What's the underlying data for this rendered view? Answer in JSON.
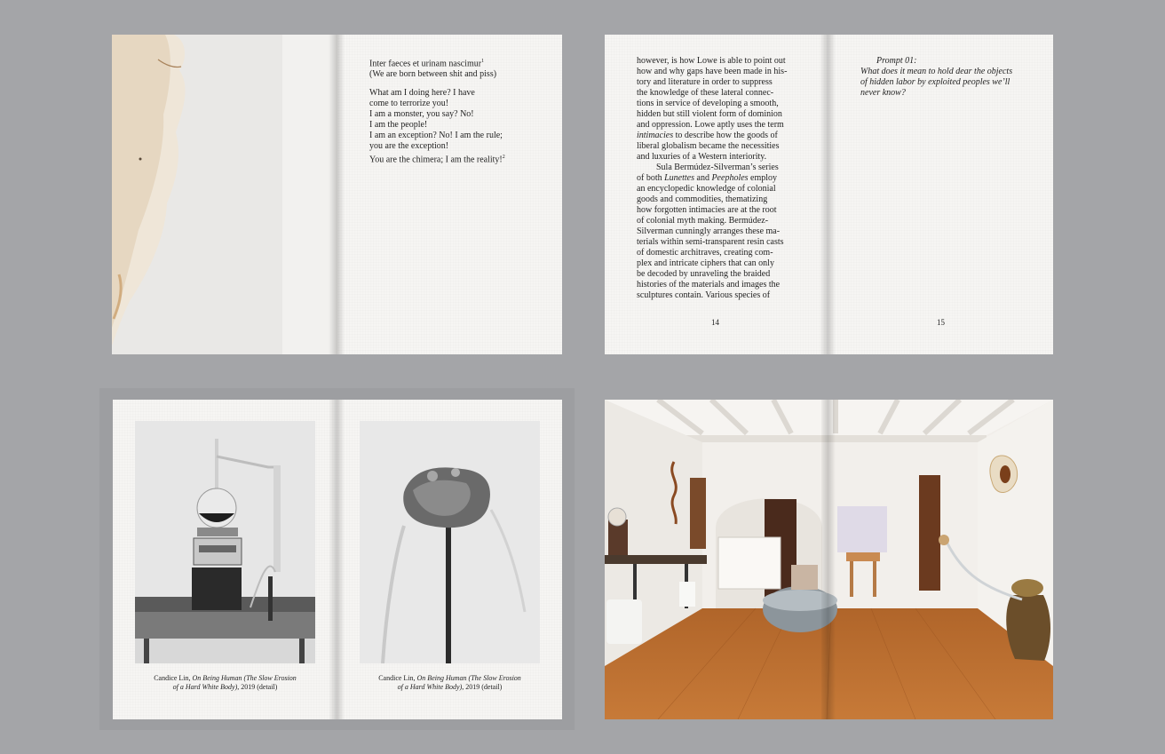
{
  "spread1": {
    "quote": {
      "latin": "Inter faeces et urinam nascimur",
      "latin_note": "1",
      "translation": "(We are born between shit and piss)"
    },
    "poem_lines": [
      "What am I doing here? I have",
      "come to terrorize you!",
      "I am a monster, you say? No!",
      "I am the people!",
      "I am an exception? No! I am the rule;",
      "you are the exception!"
    ],
    "poem_last": "You are the chimera; I am the reality!",
    "poem_last_note": "2"
  },
  "spread2": {
    "left_lines": [
      "however, is how Lowe is able to point out",
      "how and why gaps have been made in his-",
      "tory and literature in order to suppress",
      "the knowledge of these lateral connec-",
      "tions in service of developing a smooth,",
      "hidden but still violent form of dominion",
      "and oppression. Lowe aptly uses the term"
    ],
    "intimacies_word": "intimacies",
    "intimacies_rest": " to describe how the goods of",
    "left_lines_b": [
      "liberal globalism became the necessities",
      "and luxuries of a Western interiority."
    ],
    "para2_start": "Sula Bermúdez-Silverman’s series",
    "para2_of_both": "of both ",
    "lunettes": "Lunettes",
    "and_word": " and ",
    "peepholes": "Peepholes",
    "employ": " employ",
    "left_lines_c": [
      "an encyclopedic knowledge of colonial",
      "goods and commodities, thematizing",
      "how forgotten intimacies are at the root",
      "of colonial myth making. Bermúdez-",
      "Silverman cunningly arranges these ma-",
      "terials within semi-transparent resin casts",
      "of domestic architraves, creating com-",
      "plex and intricate ciphers that can only",
      "be decoded by unraveling the braided",
      "histories of the materials and images the",
      "sculptures contain. Various species of"
    ],
    "page_left": "14",
    "page_right": "15",
    "prompt_title": "Prompt 01:",
    "prompt_lines": [
      "What does it mean to hold dear the objects",
      "of hidden labor by exploited peoples we’ll",
      "never know?"
    ]
  },
  "spread3": {
    "caption_artist": "Candice Lin, ",
    "caption_title_a": "On Being Human (The Slow Erosion",
    "caption_title_b": "of a Hard White Body)",
    "caption_tail": ", 2019 (detail)"
  },
  "colors": {
    "background": "#a4a5a8",
    "paper": "#f6f5f3",
    "floor": "#b86a2c"
  }
}
